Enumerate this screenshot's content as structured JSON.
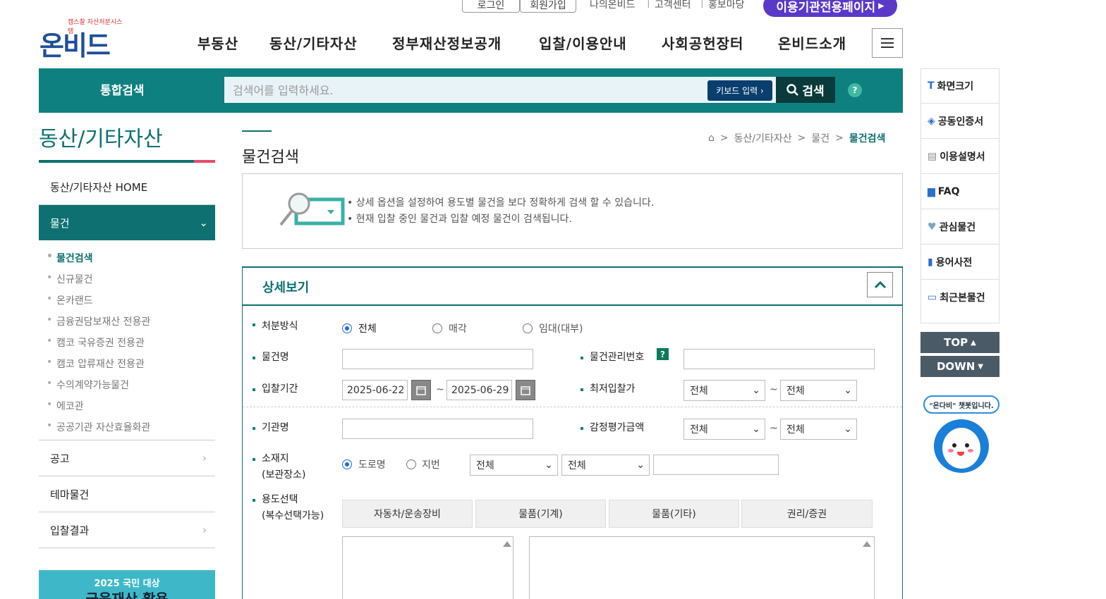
{
  "topbar": {
    "login": "로그인",
    "signup": "회원가입",
    "my": "나의온비드",
    "cs": "고객센터",
    "pr": "홍보마당",
    "org": "이용기관전용페이지"
  },
  "logo": {
    "small": "캠스찰 자산처분시스템",
    "main": "온비드"
  },
  "gnb": [
    "부동산",
    "동산/기타자산",
    "정부재산정보공개",
    "입찰/이용안내",
    "사회공헌장터",
    "온비드소개"
  ],
  "search": {
    "label": "통합검색",
    "placeholder": "검색어를 입력하세요.",
    "keyboard": "키보드 입력",
    "button": "검색",
    "help": "?"
  },
  "sidebar": {
    "title": "동산/기타자산",
    "home": "동산/기타자산 HOME",
    "active": "물건",
    "subs": [
      "물건검색",
      "신규물건",
      "온카랜드",
      "금융권담보재산 전용관",
      "캠코 국유증권 전용관",
      "캠코 압류재산 전용관",
      "수의계약가능물건",
      "에코관",
      "공공기관 자산효율화관"
    ],
    "menus": [
      "공고",
      "테마물건",
      "입찰결과"
    ],
    "banner": {
      "year": "2025 국민 대상",
      "text": "금융재산 활용"
    }
  },
  "breadcrumb": [
    "동산/기타자산",
    "물건",
    "물건검색"
  ],
  "page": {
    "title": "물건검색",
    "info1": "상세 옵션을 설정하여 용도별 물건을 보다 정확하게 검색 할 수 있습니다.",
    "info2": "현재 입찰 중인 물건과 입찰 예정 물건이 검색됩니다."
  },
  "form": {
    "section": "상세보기",
    "disposal": {
      "label": "처분방식",
      "opts": [
        "전체",
        "매각",
        "임대(대부)"
      ]
    },
    "name": {
      "label": "물건명"
    },
    "mgmt": {
      "label": "물건관리번호",
      "help": "?"
    },
    "period": {
      "label": "입찰기간",
      "from": "2025-06-22",
      "to": "2025-06-29",
      "sep": "~"
    },
    "minbid": {
      "label": "최저입찰가",
      "a": "전체",
      "b": "전체",
      "sep": "~"
    },
    "org": {
      "label": "기관명"
    },
    "appraisal": {
      "label": "감정평가금액",
      "a": "전체",
      "b": "전체",
      "sep": "~"
    },
    "loc": {
      "label1": "소재지",
      "label2": "(보관장소)",
      "opts": [
        "도로명",
        "지번"
      ],
      "s1": "전체",
      "s2": "전체"
    },
    "use": {
      "label1": "용도선택",
      "label2": "(복수선택가능)",
      "tabs": [
        "자동차/운송장비",
        "물품(기계)",
        "물품(기타)",
        "권리/증권"
      ]
    }
  },
  "quick": [
    "화면크기",
    "공동인증서",
    "이용설명서",
    "FAQ",
    "관심물건",
    "용어사전",
    "최근본물건"
  ],
  "top": "TOP",
  "down": "DOWN",
  "chatbot": "\"온다비\" 챗봇입니다."
}
